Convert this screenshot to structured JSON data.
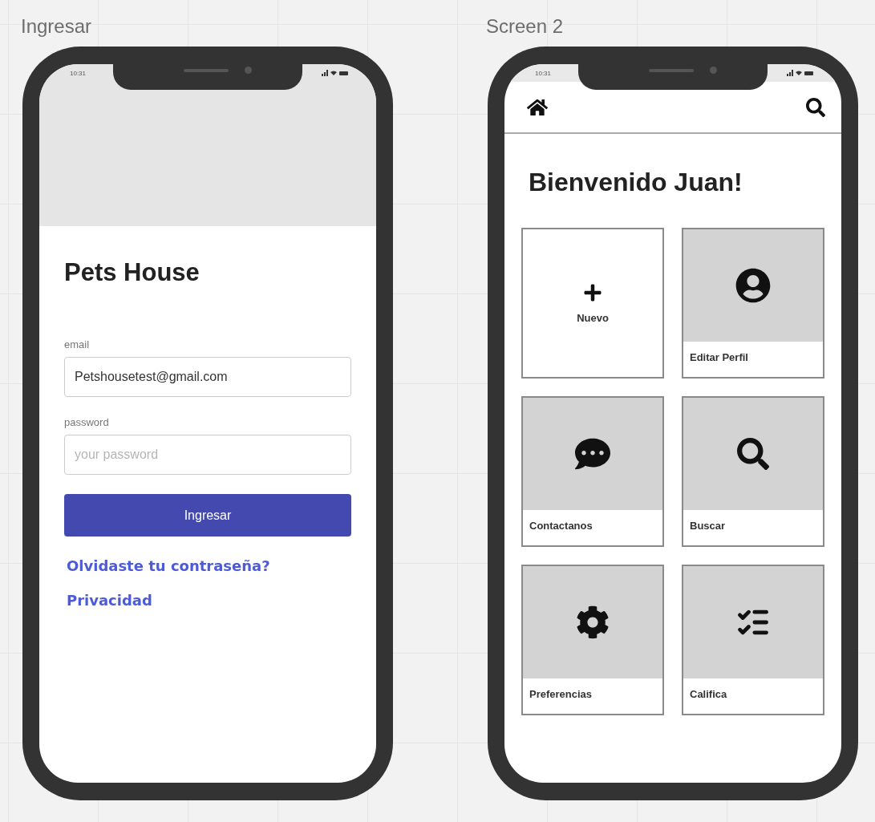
{
  "frames": [
    {
      "title": "Ingresar",
      "kind": "login",
      "status_time": "10:31",
      "app_title": "Pets House",
      "fields": [
        {
          "label": "email",
          "value": "Petshousetest@gmail.com"
        },
        {
          "label": "password",
          "placeholder": "your password"
        }
      ],
      "submit_button": "Ingresar",
      "links": [
        "Olvidaste tu contraseña?",
        "Privacidad"
      ]
    },
    {
      "title": "Screen 2",
      "kind": "home",
      "status_time": "10:31",
      "heading": "Bienvenido Juan!",
      "tiles": [
        {
          "label": "Nuevo",
          "kind": "add"
        },
        {
          "label": "Editar Perfil",
          "kind": "image"
        },
        {
          "label": "Contactanos",
          "kind": "image"
        },
        {
          "label": "Buscar",
          "kind": "image"
        },
        {
          "label": "Preferencias",
          "kind": "image"
        },
        {
          "label": "Califica",
          "kind": "image"
        }
      ]
    }
  ]
}
